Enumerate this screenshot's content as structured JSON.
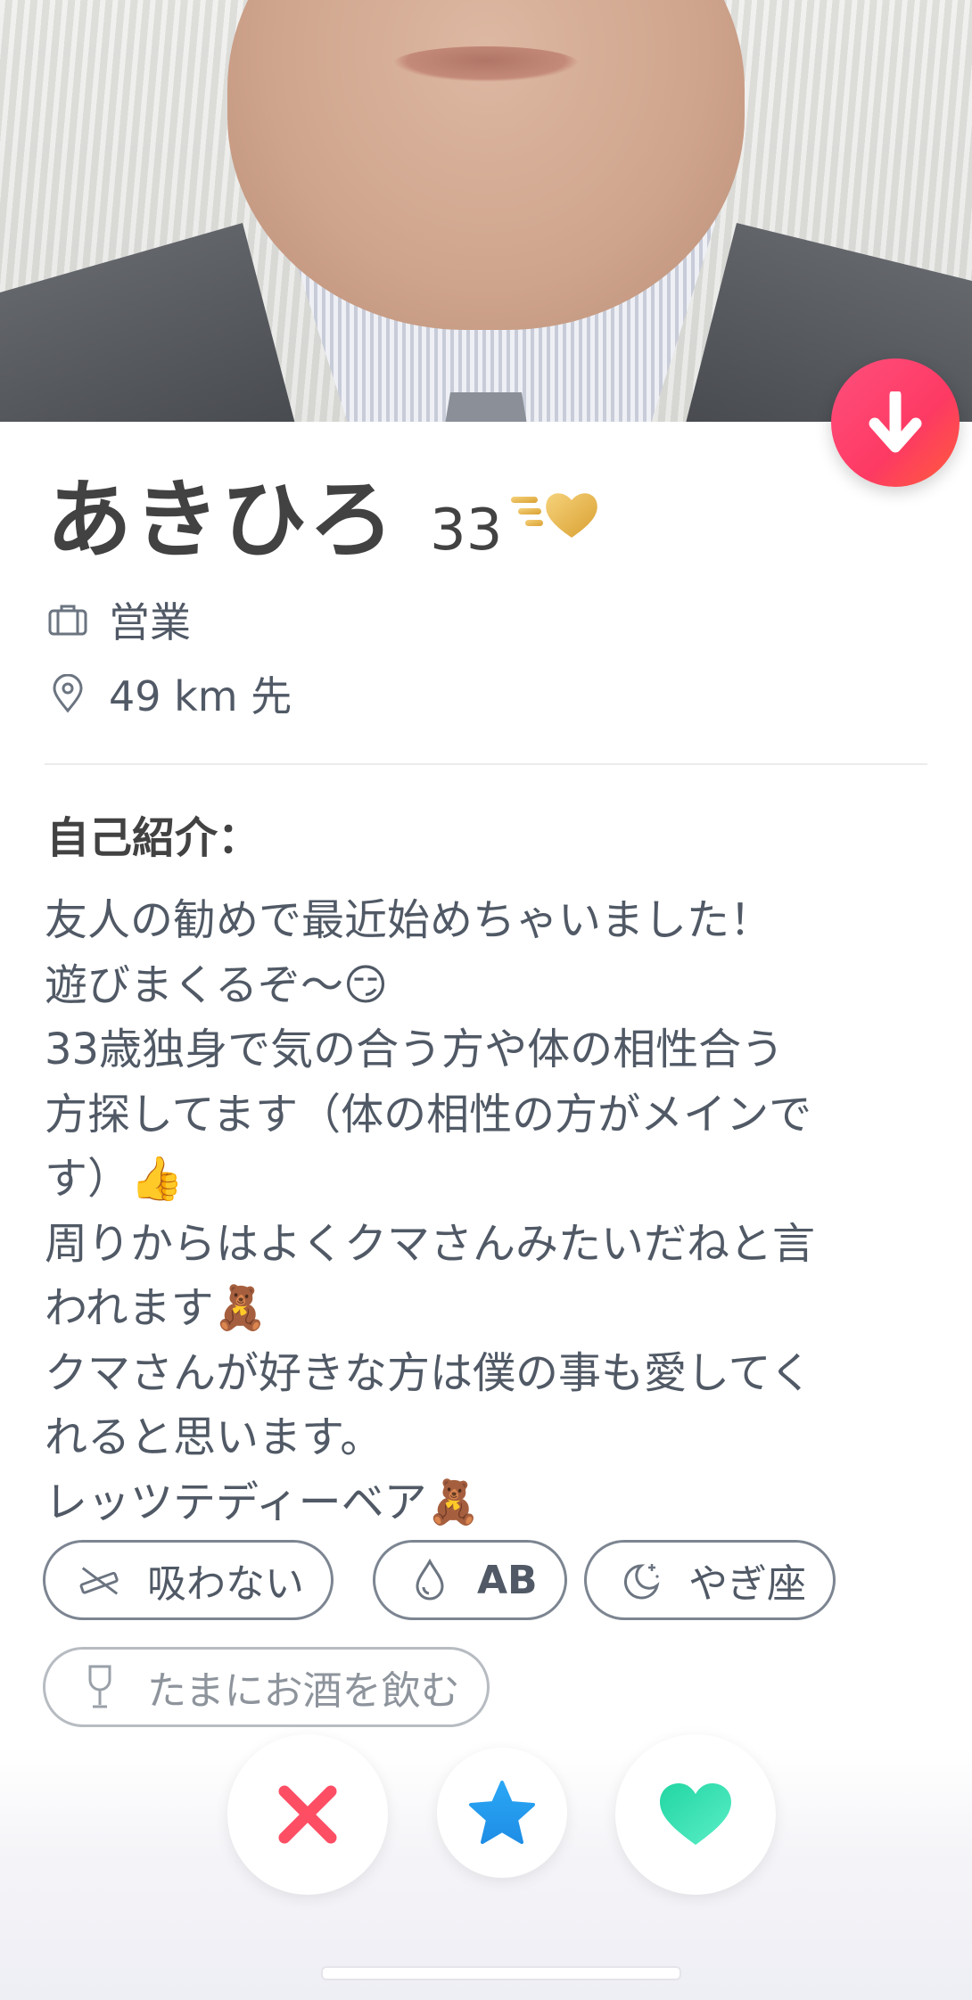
{
  "profile": {
    "name": "あきひろ",
    "age": "33",
    "job": "営業",
    "distance": "49 km 先"
  },
  "bio": {
    "heading": "自己紹介：",
    "text": "友人の勧めで最近始めちゃいました！\n遊びまくるぞ〜😏\n33歳独身で気の合う方や体の相性合う\n方探してます（体の相性の方がメインで\nす）👍\n周りからはよくクマさんみたいだねと言\nわれます🧸\nクマさんが好きな方は僕の事も愛してく\nれると思います。\nレッツテディーベア🧸"
  },
  "tags": [
    {
      "label": "吸わない",
      "icon": "no-smoking-icon"
    },
    {
      "label": "AB",
      "icon": "blood-drop-icon"
    },
    {
      "label": "やぎ座",
      "icon": "moon-stars-icon"
    },
    {
      "label": "たまにお酒を飲む",
      "icon": "wine-glass-icon"
    }
  ],
  "icons": {
    "collapse": "arrow-down-icon",
    "job": "briefcase-icon",
    "location": "location-pin-icon",
    "badge": "gold-heart-icon",
    "nope": "close-x-icon",
    "super_like": "star-icon",
    "like": "heart-icon"
  },
  "colors": {
    "brand_gradient_start": "#ff4f7d",
    "brand_gradient_end": "#ff5d3a",
    "nope": "#fd4e64",
    "super_like": "#2d9cf0",
    "like": "#3fe5b3",
    "gold": "#e8b64b"
  }
}
